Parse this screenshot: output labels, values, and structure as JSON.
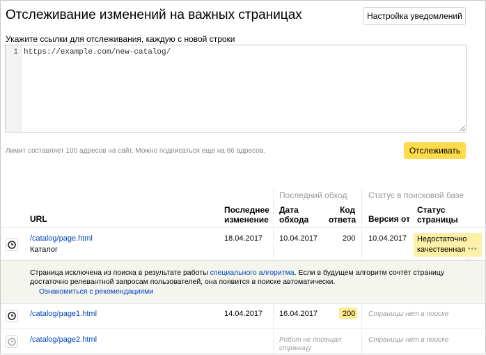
{
  "header": {
    "title": "Отслеживание изменений на важных страницах",
    "settings_button": "Настройка уведомлений"
  },
  "form": {
    "label": "Укажите ссылки для отслеживания, каждую с новой строки",
    "line_number": "1",
    "value": "https://example.com/new-catalog/",
    "limit_text": "Лимит составляет 100 адресов на сайт. Можно подписаться еще на 66 адресов.",
    "track_button": "Отслеживать"
  },
  "table": {
    "group_last_crawl": "Последний обход",
    "group_search_status": "Статус в поисковой базе",
    "headers": {
      "url": "URL",
      "last_change_1": "Последнее",
      "last_change_2": "изменение",
      "crawl_date_1": "Дата",
      "crawl_date_2": "обхода",
      "response_code_1": "Код",
      "response_code_2": "ответа",
      "version": "Версия от",
      "status_1": "Статус",
      "status_2": "страницы"
    },
    "rows": [
      {
        "url": "/catalog/page.html",
        "subtitle": "Каталог",
        "last_change": "18.04.2017",
        "crawl_date": "10.04.2017",
        "code": "200",
        "version": "10.04.2017",
        "status_1": "Недостаточно",
        "status_2": "качественная",
        "status_more": "•••"
      },
      {
        "url": "/catalog/page1.html",
        "last_change": "14.04.2017",
        "crawl_date": "16.04.2017",
        "code": "200",
        "status": "Страницы нет в поиске"
      },
      {
        "url": "/catalog/page2.html",
        "crawl_note_1": "Робот не посещал",
        "crawl_note_2": "страницу",
        "status": "Страницы нет в поиске"
      }
    ],
    "detail": {
      "text_before": "Страница исключена из поиска в результате работы ",
      "text_link": "специального алгоритма",
      "text_after": ". Если в будущем алгоритм сочтёт страницу достаточно релевантной запросам пользователей, она появится в поиске автоматически.",
      "recommendations_link": "Ознакомиться с рекомендациями"
    }
  },
  "icons": {
    "clock": "clock-icon",
    "more": "more-dots-icon"
  }
}
